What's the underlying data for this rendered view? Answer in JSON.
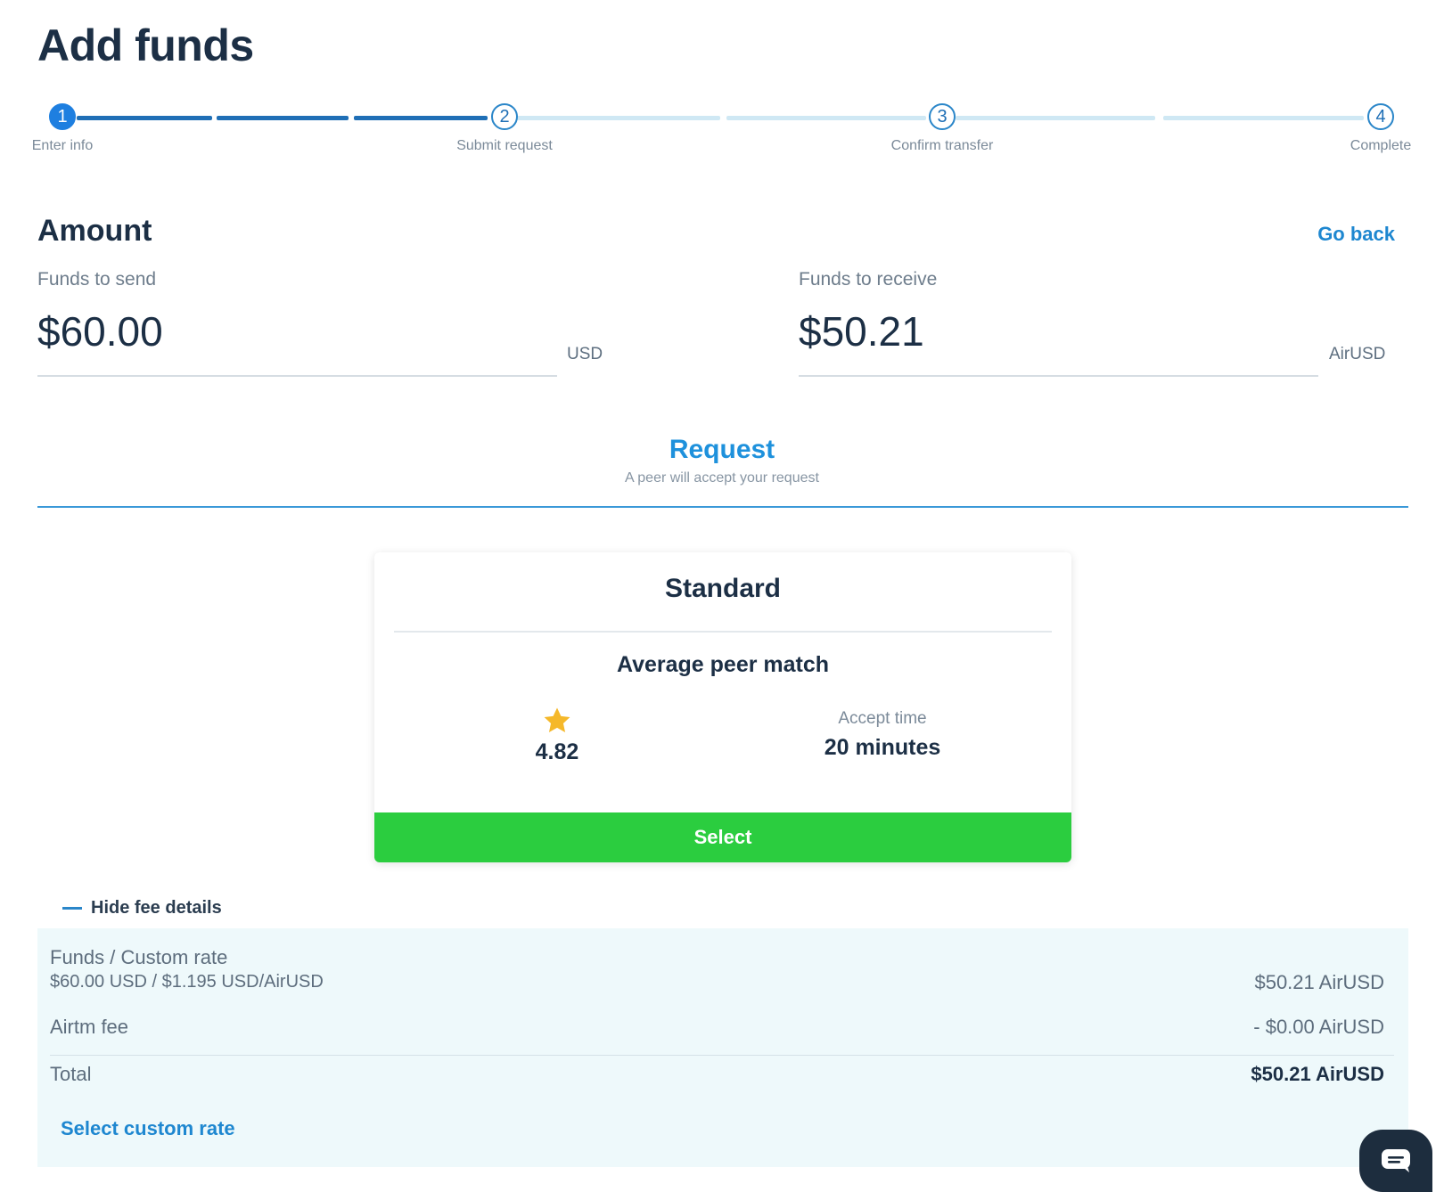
{
  "page": {
    "title": "Add funds"
  },
  "stepper": {
    "steps": [
      {
        "number": "1",
        "label": "Enter info"
      },
      {
        "number": "2",
        "label": "Submit request"
      },
      {
        "number": "3",
        "label": "Confirm transfer"
      },
      {
        "number": "4",
        "label": "Complete"
      }
    ],
    "current_step": 1
  },
  "amount": {
    "title": "Amount",
    "go_back": "Go back",
    "send": {
      "label": "Funds to send",
      "value": "$60.00",
      "unit": "USD"
    },
    "receive": {
      "label": "Funds to receive",
      "value": "$50.21",
      "unit": "AirUSD"
    }
  },
  "request_tab": {
    "title": "Request",
    "subtitle": "A peer will accept your request"
  },
  "option_card": {
    "title": "Standard",
    "subtitle": "Average peer match",
    "rating": "4.82",
    "accept_label": "Accept time",
    "accept_value": "20 minutes",
    "select_label": "Select"
  },
  "fees": {
    "toggle_label": "Hide fee details",
    "rate_label": "Funds / Custom rate",
    "rate_detail": "$60.00 USD / $1.195 USD/AirUSD",
    "rate_value": "$50.21 AirUSD",
    "fee_label": "Airtm fee",
    "fee_value": "- $0.00 AirUSD",
    "total_label": "Total",
    "total_value": "$50.21 AirUSD",
    "custom_rate_link": "Select custom rate"
  },
  "colors": {
    "accent": "#1e87d0",
    "step_active": "#1e7fe0",
    "select_button": "#2bcd3f",
    "star": "#f5b82a",
    "fee_panel_bg": "#eef9fb"
  },
  "icons": {
    "rating": "star-icon",
    "toggle": "minus-icon",
    "chat": "chat-icon"
  }
}
